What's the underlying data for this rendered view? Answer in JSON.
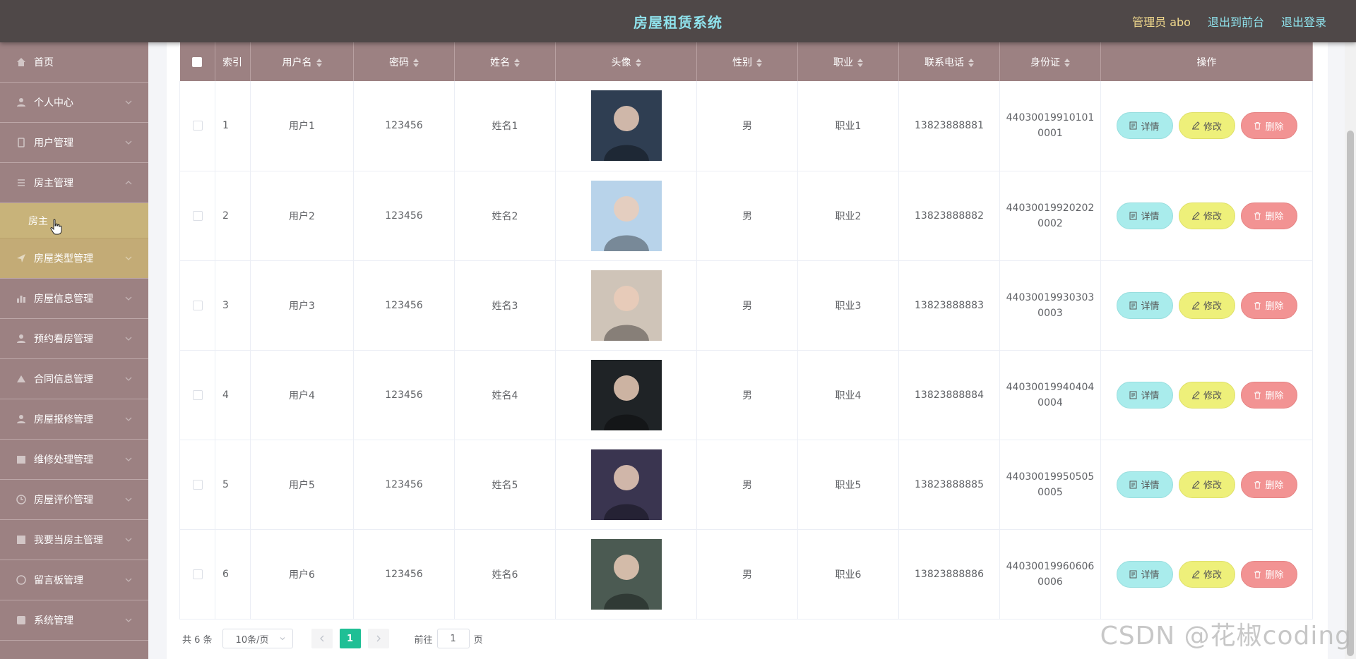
{
  "header": {
    "title": "房屋租赁系统",
    "admin": "管理员 abo",
    "to_front": "退出到前台",
    "logout": "退出登录"
  },
  "sidebar": {
    "items": [
      {
        "label": "首页",
        "icon": "home-icon"
      },
      {
        "label": "个人中心",
        "icon": "user-icon"
      },
      {
        "label": "用户管理",
        "icon": "users-icon"
      },
      {
        "label": "房主管理",
        "icon": "list-icon",
        "expanded": true
      },
      {
        "label": "房屋类型管理",
        "icon": "send-icon"
      },
      {
        "label": "房屋信息管理",
        "icon": "chart-icon"
      },
      {
        "label": "预约看房管理",
        "icon": "user-icon"
      },
      {
        "label": "合同信息管理",
        "icon": "doc-icon"
      },
      {
        "label": "房屋报修管理",
        "icon": "user-icon"
      },
      {
        "label": "维修处理管理",
        "icon": "calendar-icon"
      },
      {
        "label": "房屋评价管理",
        "icon": "clock-icon"
      },
      {
        "label": "我要当房主管理",
        "icon": "grid-icon"
      },
      {
        "label": "留言板管理",
        "icon": "chat-icon"
      },
      {
        "label": "系统管理",
        "icon": "settings-icon"
      }
    ],
    "sub_item": "房主"
  },
  "table": {
    "headers": {
      "index": "索引",
      "username": "用户名",
      "password": "密码",
      "name": "姓名",
      "avatar": "头像",
      "gender": "性别",
      "job": "职业",
      "phone": "联系电话",
      "idcard": "身份证",
      "action": "操作"
    },
    "rows": [
      {
        "index": "1",
        "username": "用户1",
        "password": "123456",
        "name": "姓名1",
        "gender": "男",
        "job": "职业1",
        "phone": "13823888881",
        "idcard_1": "44030019910101",
        "idcard_2": "0001",
        "avatar_color": "#2f3e52"
      },
      {
        "index": "2",
        "username": "用户2",
        "password": "123456",
        "name": "姓名2",
        "gender": "男",
        "job": "职业2",
        "phone": "13823888882",
        "idcard_1": "44030019920202",
        "idcard_2": "0002",
        "avatar_color": "#b8d3ea"
      },
      {
        "index": "3",
        "username": "用户3",
        "password": "123456",
        "name": "姓名3",
        "gender": "男",
        "job": "职业3",
        "phone": "13823888883",
        "idcard_1": "44030019930303",
        "idcard_2": "0003",
        "avatar_color": "#cfc4b8"
      },
      {
        "index": "4",
        "username": "用户4",
        "password": "123456",
        "name": "姓名4",
        "gender": "男",
        "job": "职业4",
        "phone": "13823888884",
        "idcard_1": "44030019940404",
        "idcard_2": "0004",
        "avatar_color": "#1f2326"
      },
      {
        "index": "5",
        "username": "用户5",
        "password": "123456",
        "name": "姓名5",
        "gender": "男",
        "job": "职业5",
        "phone": "13823888885",
        "idcard_1": "44030019950505",
        "idcard_2": "0005",
        "avatar_color": "#3a3550"
      },
      {
        "index": "6",
        "username": "用户6",
        "password": "123456",
        "name": "姓名6",
        "gender": "男",
        "job": "职业6",
        "phone": "13823888886",
        "idcard_1": "44030019960606",
        "idcard_2": "0006",
        "avatar_color": "#4b5a52"
      }
    ],
    "actions": {
      "detail": "详情",
      "edit": "修改",
      "delete": "删除"
    }
  },
  "pagination": {
    "total": "共 6 条",
    "page_size": "10条/页",
    "current_page": "1",
    "goto_label": "前往",
    "goto_value": "1",
    "page_suffix": "页"
  },
  "watermark": "CSDN @花椒coding",
  "colors": {
    "header_bg": "#4f4848",
    "title": "#8fe2ec",
    "admin": "#f1d98d",
    "sidebar_bg": "#9c8182",
    "active_menu": "#c3ab76",
    "detail_btn": "#a9ecec",
    "edit_btn": "#eef07a",
    "delete_btn": "#f29393",
    "page_active": "#1fbf95"
  }
}
